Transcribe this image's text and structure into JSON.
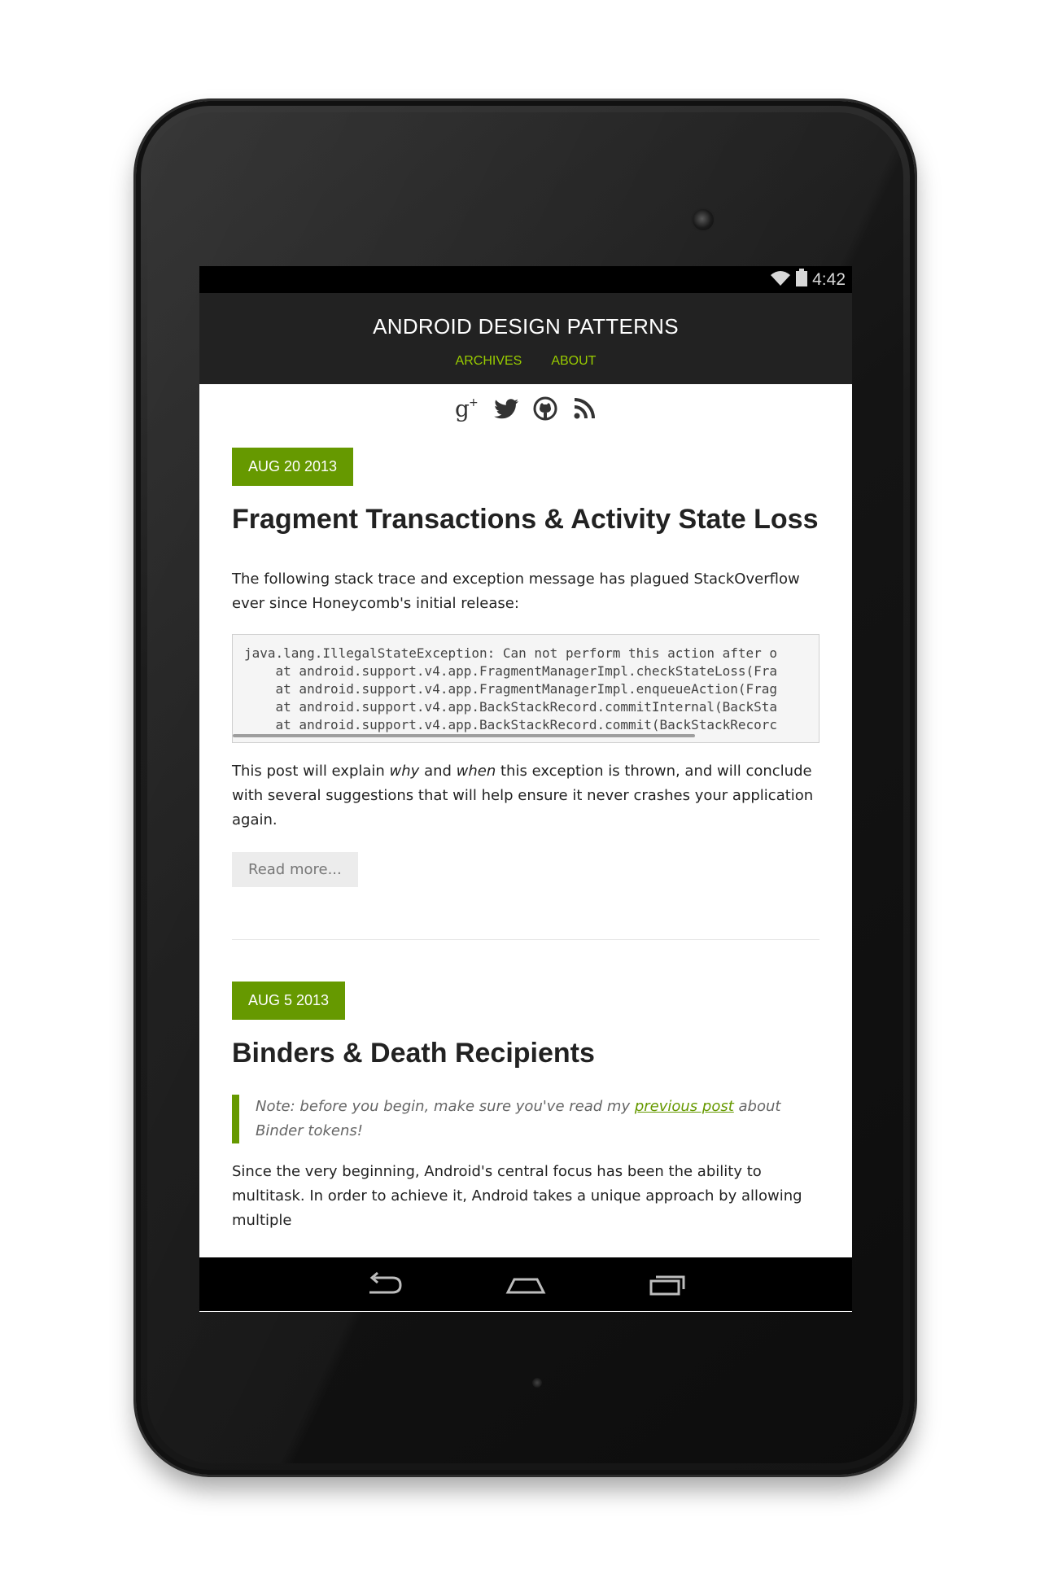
{
  "status_bar": {
    "time": "4:42",
    "wifi_icon": "wifi-icon",
    "battery_icon": "battery-icon"
  },
  "header": {
    "site_title": "ANDROID DESIGN PATTERNS",
    "nav": [
      {
        "label": "ARCHIVES"
      },
      {
        "label": "ABOUT"
      }
    ],
    "accent_color": "#99cc00",
    "background_color": "#222222"
  },
  "social_icons": [
    "google-plus-icon",
    "twitter-icon",
    "github-icon",
    "rss-icon"
  ],
  "posts": [
    {
      "date": "AUG 20 2013",
      "title": "Fragment Transactions & Activity State Loss",
      "intro": "The following stack trace and exception message has plagued StackOverflow ever since Honeycomb's initial release:",
      "code": "java.lang.IllegalStateException: Can not perform this action after o\n    at android.support.v4.app.FragmentManagerImpl.checkStateLoss(Fra\n    at android.support.v4.app.FragmentManagerImpl.enqueueAction(Frag\n    at android.support.v4.app.BackStackRecord.commitInternal(BackSta\n    at android.support.v4.app.BackStackRecord.commit(BackStackRecorc",
      "summary_part1": "This post will explain ",
      "summary_em1": "why",
      "summary_part2": " and ",
      "summary_em2": "when",
      "summary_part3": " this exception is thrown, and will conclude with several suggestions that will help ensure it never crashes your application again.",
      "read_more": "Read more..."
    },
    {
      "date": "AUG 5 2013",
      "title": "Binders & Death Recipients",
      "note_part1": "Note: before you begin, make sure you've read my ",
      "note_link": "previous post",
      "note_part2": " about Binder tokens!",
      "body": "Since the very beginning, Android's central focus has been the ability to multitask. In order to achieve it, Android takes a unique approach by allowing multiple"
    }
  ],
  "colors": {
    "date_badge": "#669900",
    "quote_border": "#669900"
  },
  "nav_bar": [
    "back-icon",
    "home-icon",
    "recents-icon"
  ]
}
